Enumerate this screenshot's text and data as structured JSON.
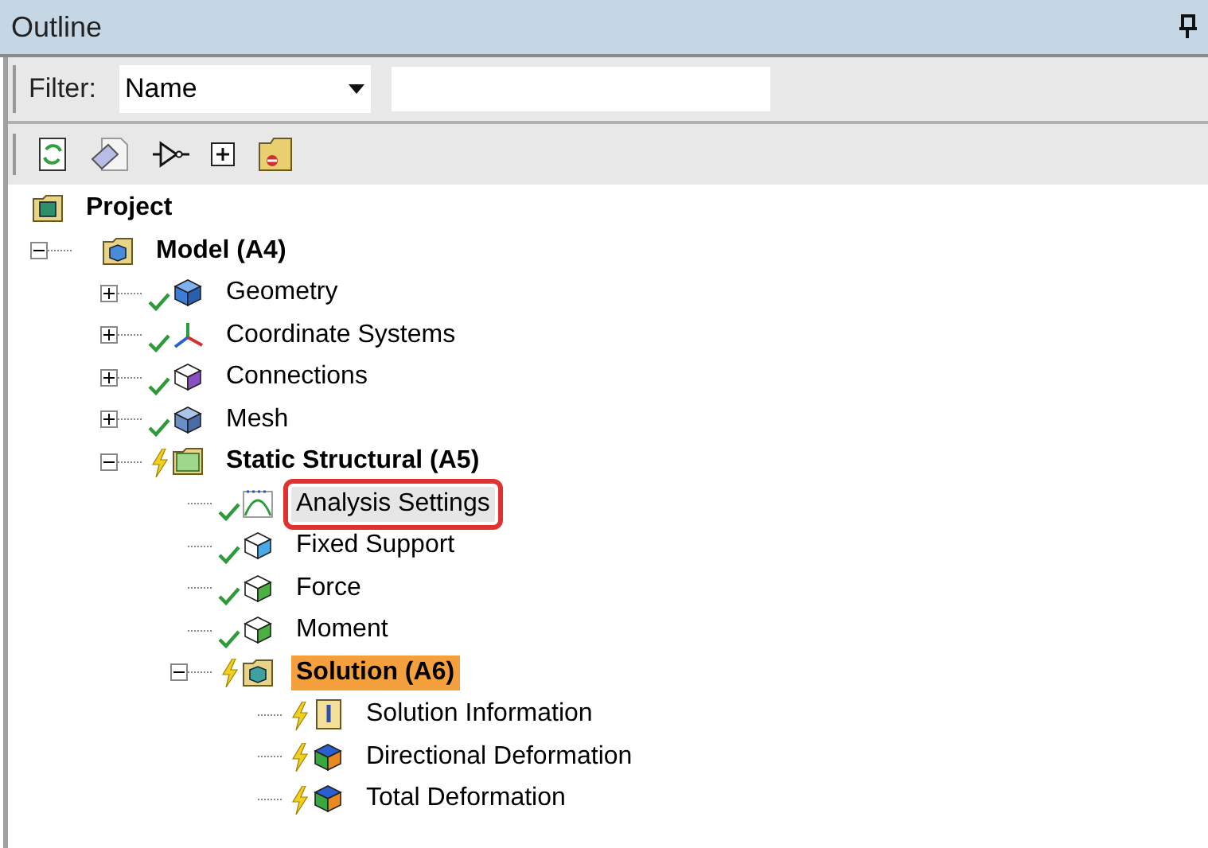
{
  "panel": {
    "title": "Outline"
  },
  "filter": {
    "label": "Filter:",
    "value": "Name"
  },
  "tree": [
    {
      "label": "Project",
      "kind": "project",
      "bold": true,
      "done": false,
      "outdated": false,
      "selected": false,
      "annotated": false,
      "children": [
        {
          "label": "Model (A4)",
          "kind": "model",
          "bold": true,
          "done": false,
          "outdated": false,
          "selected": false,
          "annotated": false,
          "expanded": true,
          "children": [
            {
              "label": "Geometry",
              "kind": "geometry",
              "bold": false,
              "done": true,
              "outdated": false,
              "selected": false,
              "annotated": false,
              "expanded": false
            },
            {
              "label": "Coordinate Systems",
              "kind": "coordinates",
              "bold": false,
              "done": true,
              "outdated": false,
              "selected": false,
              "annotated": false,
              "expanded": false
            },
            {
              "label": "Connections",
              "kind": "connections",
              "bold": false,
              "done": true,
              "outdated": false,
              "selected": false,
              "annotated": false,
              "expanded": false
            },
            {
              "label": "Mesh",
              "kind": "mesh",
              "bold": false,
              "done": true,
              "outdated": false,
              "selected": false,
              "annotated": false,
              "expanded": false
            },
            {
              "label": "Static Structural (A5)",
              "kind": "analysis",
              "bold": true,
              "done": false,
              "outdated": true,
              "selected": false,
              "annotated": false,
              "expanded": true,
              "children": [
                {
                  "label": "Analysis Settings",
                  "kind": "settings",
                  "bold": false,
                  "done": true,
                  "outdated": false,
                  "selected": false,
                  "annotated": true
                },
                {
                  "label": "Fixed Support",
                  "kind": "support",
                  "bold": false,
                  "done": true,
                  "outdated": false,
                  "selected": false,
                  "annotated": false
                },
                {
                  "label": "Force",
                  "kind": "force",
                  "bold": false,
                  "done": true,
                  "outdated": false,
                  "selected": false,
                  "annotated": false
                },
                {
                  "label": "Moment",
                  "kind": "moment",
                  "bold": false,
                  "done": true,
                  "outdated": false,
                  "selected": false,
                  "annotated": false
                },
                {
                  "label": "Solution (A6)",
                  "kind": "solution",
                  "bold": true,
                  "done": false,
                  "outdated": true,
                  "selected": true,
                  "annotated": false,
                  "expanded": true,
                  "children": [
                    {
                      "label": "Solution Information",
                      "kind": "info",
                      "bold": false,
                      "done": false,
                      "outdated": true,
                      "selected": false,
                      "annotated": false
                    },
                    {
                      "label": "Directional Deformation",
                      "kind": "result",
                      "bold": false,
                      "done": false,
                      "outdated": true,
                      "selected": false,
                      "annotated": false
                    },
                    {
                      "label": "Total Deformation",
                      "kind": "result",
                      "bold": false,
                      "done": false,
                      "outdated": true,
                      "selected": false,
                      "annotated": false
                    }
                  ]
                }
              ]
            }
          ]
        }
      ]
    }
  ]
}
